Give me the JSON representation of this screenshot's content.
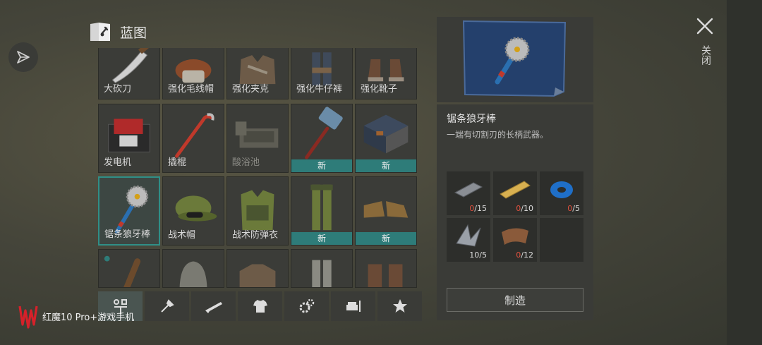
{
  "header": {
    "title": "蓝图"
  },
  "grid": {
    "rows": [
      [
        {
          "label": "大砍刀",
          "icon": "machete-icon",
          "new": "",
          "dim": false
        },
        {
          "label": "强化毛线帽",
          "icon": "reinforced-beanie-icon",
          "new": "",
          "dim": false
        },
        {
          "label": "强化夹克",
          "icon": "reinforced-jacket-icon",
          "new": "",
          "dim": false
        },
        {
          "label": "强化牛仔裤",
          "icon": "reinforced-jeans-icon",
          "new": "",
          "dim": false
        },
        {
          "label": "强化靴子",
          "icon": "reinforced-boots-icon",
          "new": "",
          "dim": false
        }
      ],
      [
        {
          "label": "发电机",
          "icon": "generator-icon",
          "new": "",
          "dim": false
        },
        {
          "label": "撬棍",
          "icon": "crowbar-icon",
          "new": "",
          "dim": false
        },
        {
          "label": "酸浴池",
          "icon": "acid-bath-icon",
          "new": "",
          "dim": true
        },
        {
          "label": "",
          "icon": "sledgehammer-icon",
          "new": "新",
          "dim": false
        },
        {
          "label": "",
          "icon": "workshop-room-icon",
          "new": "新",
          "dim": false
        }
      ],
      [
        {
          "label": "锯条狼牙棒",
          "icon": "saw-mace-icon",
          "new": "",
          "dim": false
        },
        {
          "label": "战术帽",
          "icon": "tactical-cap-icon",
          "new": "",
          "dim": false
        },
        {
          "label": "战术防弹衣",
          "icon": "tactical-vest-icon",
          "new": "",
          "dim": false
        },
        {
          "label": "",
          "icon": "tactical-pants-icon",
          "new": "新",
          "dim": false
        },
        {
          "label": "",
          "icon": "tactical-boots-icon",
          "new": "新",
          "dim": false
        }
      ]
    ],
    "partial_row": [
      "spiked-bat-icon",
      "hood-icon",
      "armor-jacket-icon",
      "pants-icon",
      "boots-icon"
    ]
  },
  "tabs": [
    {
      "name": "tab-all",
      "icon": "all-categories-icon"
    },
    {
      "name": "tab-tools",
      "icon": "tools-icon"
    },
    {
      "name": "tab-weapons",
      "icon": "rifle-icon"
    },
    {
      "name": "tab-clothing",
      "icon": "tshirt-icon"
    },
    {
      "name": "tab-equipment",
      "icon": "gears-icon"
    },
    {
      "name": "tab-furniture",
      "icon": "furniture-icon"
    },
    {
      "name": "tab-favorites",
      "icon": "star-icon"
    }
  ],
  "detail": {
    "name": "锯条狼牙棒",
    "description": "一端有切割刃的长柄武器。",
    "materials": [
      {
        "icon": "metal-bar-icon",
        "have": "0",
        "need": "/15",
        "low": true
      },
      {
        "icon": "wood-plank-icon",
        "have": "0",
        "need": "/10",
        "low": true
      },
      {
        "icon": "duct-tape-icon",
        "have": "0",
        "need": "/5",
        "low": true
      },
      {
        "icon": "metal-scraps-icon",
        "have": "10",
        "need": "/5",
        "low": false
      },
      {
        "icon": "leather-icon",
        "have": "0",
        "need": "/12",
        "low": true
      }
    ],
    "craft_label": "制造"
  },
  "close_label": "关闭",
  "watermark": "红魔10 Pro+游戏手机",
  "colors": {
    "accent": "#2e7c79",
    "missing": "#e0513f",
    "panel": "#3a3b37"
  }
}
